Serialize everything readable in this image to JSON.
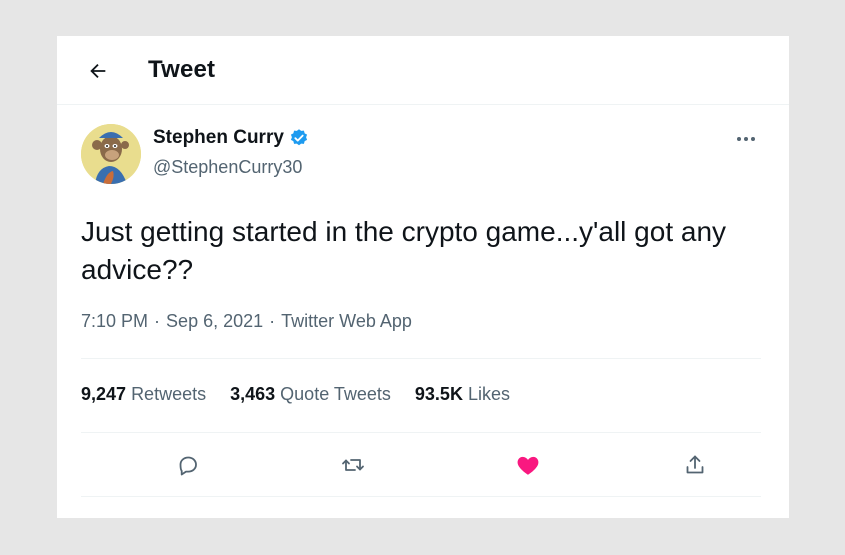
{
  "header": {
    "title": "Tweet"
  },
  "tweet": {
    "author_name": "Stephen Curry",
    "handle": "@StephenCurry30",
    "text": "Just getting started in the crypto game...y'all got any advice??",
    "time": "7:10 PM",
    "date": "Sep 6, 2021",
    "source": "Twitter Web App",
    "separator": "·"
  },
  "stats": {
    "retweets_count": "9,247",
    "retweets_label": "Retweets",
    "quotes_count": "3,463",
    "quotes_label": "Quote Tweets",
    "likes_count": "93.5K",
    "likes_label": "Likes"
  },
  "icons": {
    "back": "arrow-left-icon",
    "verified": "verified-badge-icon",
    "more": "more-options-icon",
    "reply": "reply-icon",
    "retweet": "retweet-icon",
    "like": "heart-icon",
    "share": "share-icon"
  },
  "colors": {
    "verified": "#1d9bf0",
    "like": "#f91880",
    "secondary_text": "#536471"
  }
}
